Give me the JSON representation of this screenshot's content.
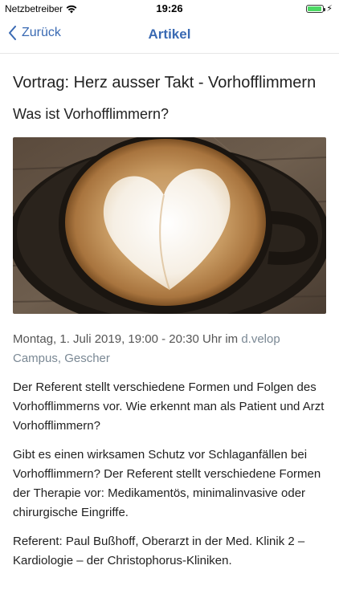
{
  "status_bar": {
    "carrier": "Netzbetreiber",
    "time": "19:26",
    "battery_level": 0.9,
    "icons": [
      "wifi-icon",
      "battery-icon",
      "charging-bolt-icon"
    ]
  },
  "nav": {
    "back_label": "Zurück",
    "title": "Artikel",
    "accent_color": "#3a6ab3"
  },
  "article": {
    "title": "Vortrag: Herz ausser Takt - Vorhofflimmern",
    "subtitle": "Was ist Vorhofflimmern?",
    "image_description_icon": "latte-art-heart-image",
    "meta_prefix": "Montag, 1. Juli 2019, 19:00 - 20:30 Uhr im ",
    "location_link": "d.velop Campus, Gescher",
    "paragraphs": [
      "Der Referent stellt verschiedene Formen und Folgen des Vorhofflimmerns vor. Wie erkennt man als Patient und Arzt Vorhofflimmern?",
      "Gibt es einen wirksamen Schutz vor Schlaganfällen bei Vorhofflimmern? Der Referent stellt verschiedene Formen der Therapie vor: Medikamentös, minimalinvasive oder chirurgische Eingriffe.",
      "Referent: Paul Bußhoff, Oberarzt in der Med. Klinik 2 – Kardiologie – der Christophorus-Kliniken."
    ]
  }
}
